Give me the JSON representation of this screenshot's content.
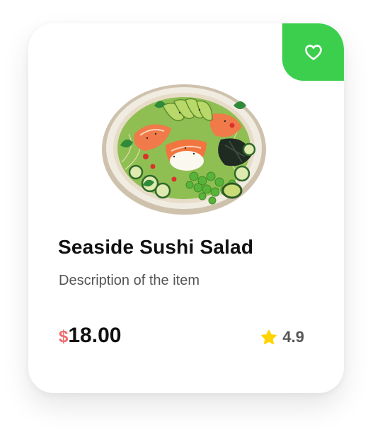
{
  "card": {
    "title": "Seaside Sushi Salad",
    "description": "Description of the item",
    "price": {
      "currency_symbol": "$",
      "amount": "18.00"
    },
    "rating": "4.9",
    "favorite_icon": "heart-outline-icon",
    "rating_icon": "star-icon",
    "image_alt": "sushi salad bowl"
  },
  "colors": {
    "accent_green": "#3ccf4e",
    "currency_red": "#f06a6a",
    "star_yellow": "#ffd400"
  }
}
